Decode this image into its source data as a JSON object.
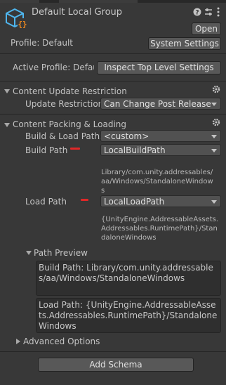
{
  "header": {
    "title": "Default Local Group",
    "open_label": "Open",
    "icons": [
      "help-icon",
      "presets-icon",
      "more-menu-icon",
      "addressables-group-icon"
    ]
  },
  "profile": {
    "label": "Profile: Default",
    "system_settings_label": "System Settings"
  },
  "active_profile": {
    "label": "Active Profile: Defau",
    "inspect_label": "Inspect Top Level Settings"
  },
  "content_update": {
    "title": "Content Update Restriction",
    "restriction_label": "Update Restriction",
    "restriction_value": "Can Change Post Release"
  },
  "packing": {
    "title": "Content Packing & Loading",
    "build_load_paths_label": "Build & Load Paths",
    "build_load_paths_value": "<custom>",
    "build_path_label": "Build Path",
    "build_path_value": "LocalBuildPath",
    "build_path_hint": "Library/com.unity.addressables/aa/Windows/StandaloneWindows",
    "load_path_label": "Load Path",
    "load_path_value": "LocalLoadPath",
    "load_path_hint": "{UnityEngine.AddressableAssets.Addressables.RuntimePath}/StandaloneWindows"
  },
  "path_preview": {
    "title": "Path Preview",
    "build": "Build Path: Library/com.unity.addressables/aa/Windows/StandaloneWindows",
    "load": "Load Path: {UnityEngine.AddressableAssets.Addressables.RuntimePath}/StandaloneWindows"
  },
  "advanced": {
    "title": "Advanced Options"
  },
  "footer": {
    "add_schema_label": "Add Schema"
  },
  "colors": {
    "background": "#383838",
    "annotation_red": "#e02828"
  }
}
